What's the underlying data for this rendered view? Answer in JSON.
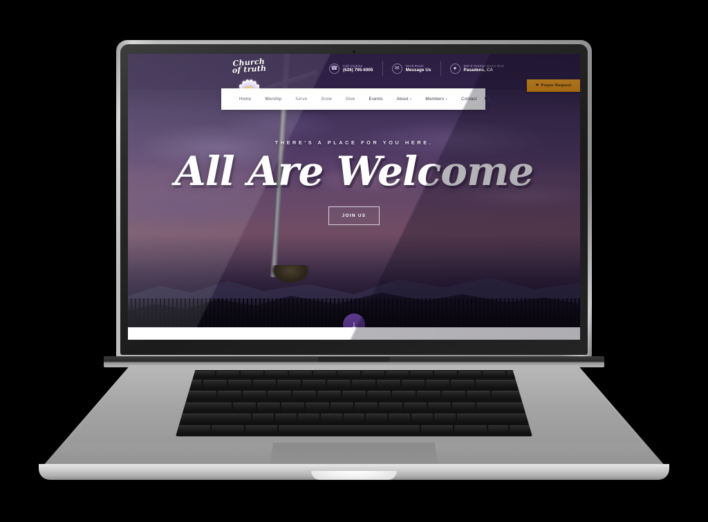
{
  "device": {
    "type": "laptop-mockup",
    "name": "MacBook Pro"
  },
  "site": {
    "logo": {
      "line1": "Church",
      "line2": "of truth",
      "icon": "lotus-flower-icon"
    },
    "contact": [
      {
        "icon": "phone-icon",
        "label": "Call Anytime",
        "value": "(626) 795-6905"
      },
      {
        "icon": "envelope-icon",
        "label": "Send Email",
        "value": "Message Us"
      },
      {
        "icon": "map-pin-icon",
        "label": "690 E Orange Grove Blvd",
        "value": "Pasadena, CA"
      }
    ],
    "prayer_button": {
      "label": "Prayer Request",
      "icon": "heart-icon",
      "color": "#f5a623"
    },
    "nav": [
      {
        "label": "Home",
        "has_caret": false,
        "active": true
      },
      {
        "label": "Worship",
        "has_caret": false,
        "active": false
      },
      {
        "label": "Serve",
        "has_caret": false,
        "active": false
      },
      {
        "label": "Grow",
        "has_caret": false,
        "active": false
      },
      {
        "label": "Give",
        "has_caret": false,
        "active": false
      },
      {
        "label": "Events",
        "has_caret": false,
        "active": true
      },
      {
        "label": "About",
        "has_caret": true,
        "active": true
      },
      {
        "label": "Members",
        "has_caret": true,
        "active": true
      },
      {
        "label": "Contact",
        "has_caret": false,
        "active": true
      }
    ],
    "search_icon": "search-icon",
    "hero": {
      "eyebrow": "THERE'S A PLACE FOR YOU HERE.",
      "headline": "All Are Welcome",
      "cta": "JOIN US",
      "scroll_icon": "arrow-down-icon",
      "background": "cross-on-hilltop-at-twilight"
    },
    "colors": {
      "accent_orange": "#f5a623",
      "accent_purple": "#4b2a74",
      "header_purple": "#2c1e42",
      "nav_background": "#ffffff"
    }
  }
}
